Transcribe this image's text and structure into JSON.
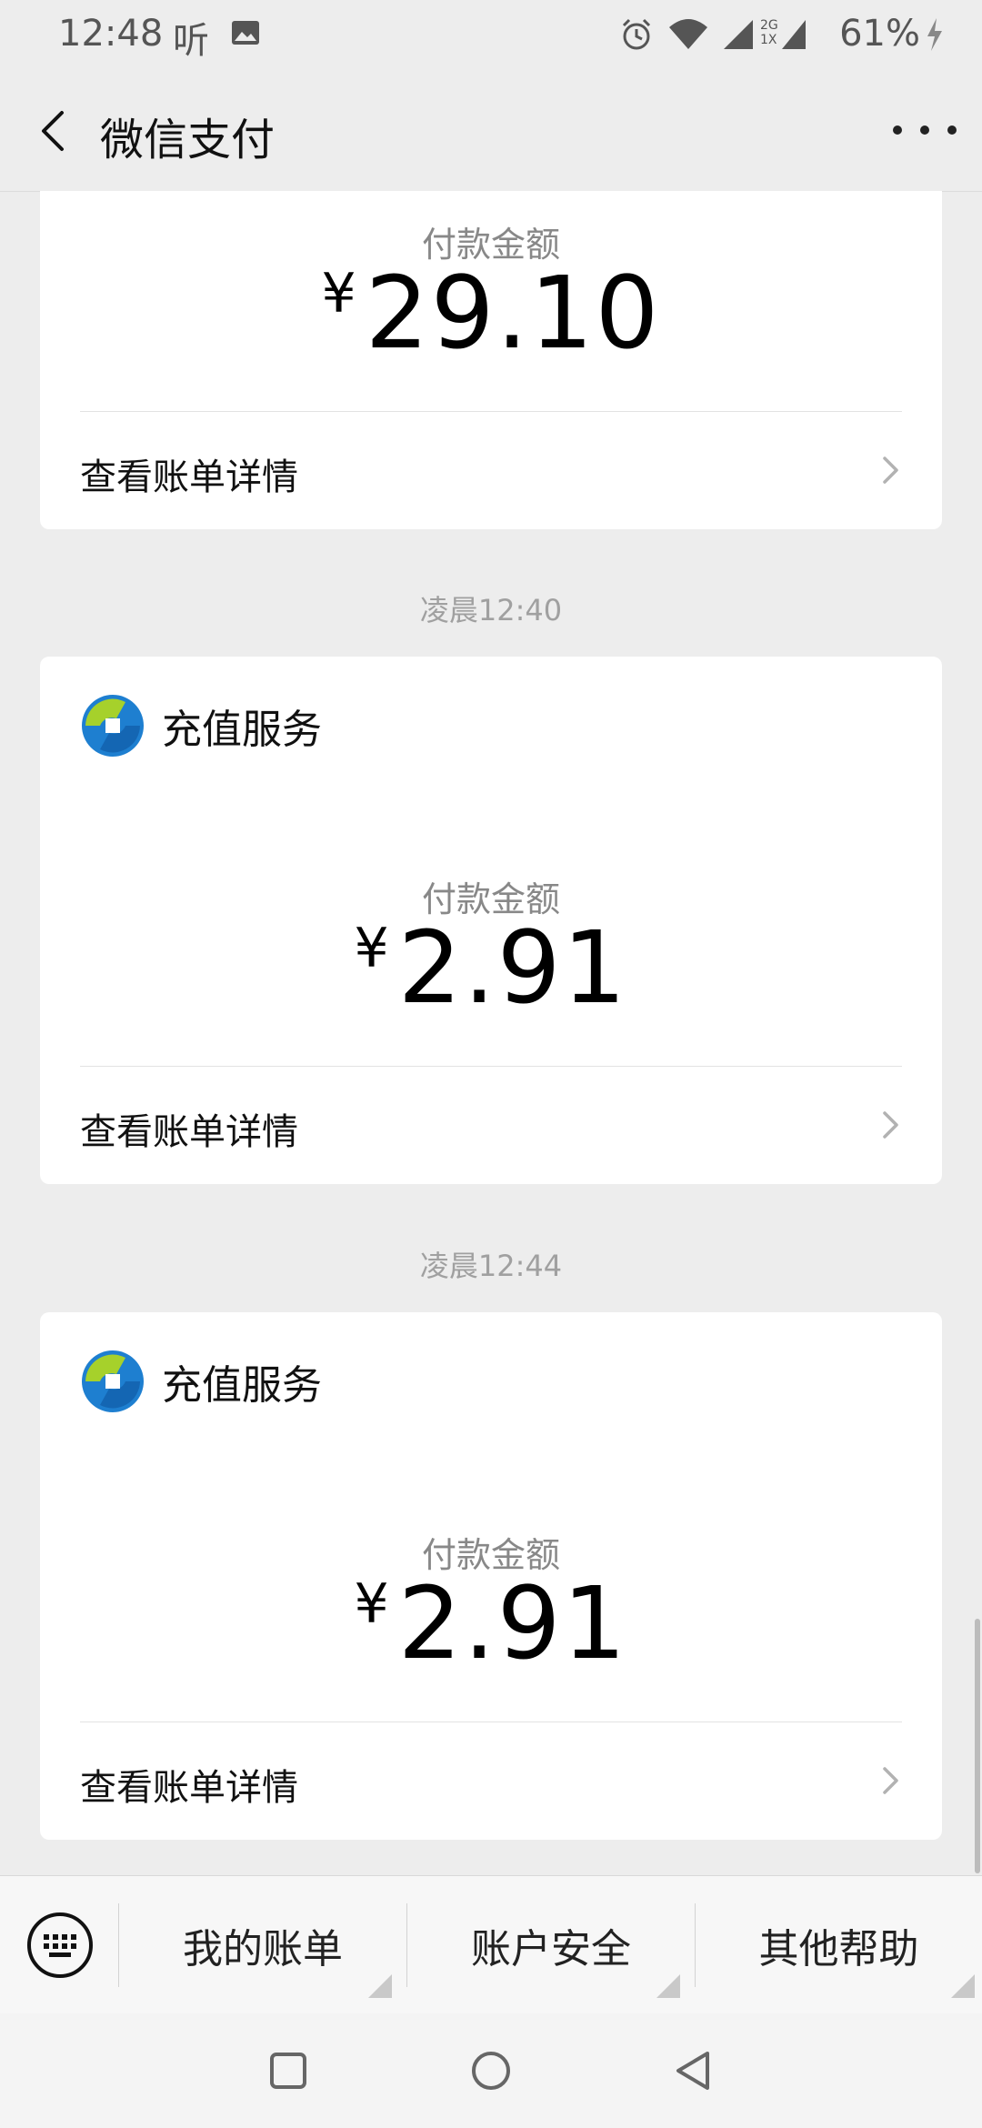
{
  "status_bar": {
    "time": "12:48",
    "app_indicator": "听",
    "network_label_top": "2G",
    "network_label_bottom": "1X",
    "battery": "61%"
  },
  "header": {
    "title": "微信支付"
  },
  "cards": [
    {
      "amount_label": "付款金额",
      "currency": "¥",
      "amount": "29.10",
      "detail_label": "查看账单详情"
    },
    {
      "time": "凌晨12:40",
      "merchant": "充值服务",
      "amount_label": "付款金额",
      "currency": "¥",
      "amount": "2.91",
      "detail_label": "查看账单详情"
    },
    {
      "time": "凌晨12:44",
      "merchant": "充值服务",
      "amount_label": "付款金额",
      "currency": "¥",
      "amount": "2.91",
      "detail_label": "查看账单详情"
    }
  ],
  "bottom_menu": {
    "items": [
      "我的账单",
      "账户安全",
      "其他帮助"
    ]
  },
  "colors": {
    "background": "#ededed",
    "card": "#ffffff",
    "muted_text": "#888888"
  }
}
